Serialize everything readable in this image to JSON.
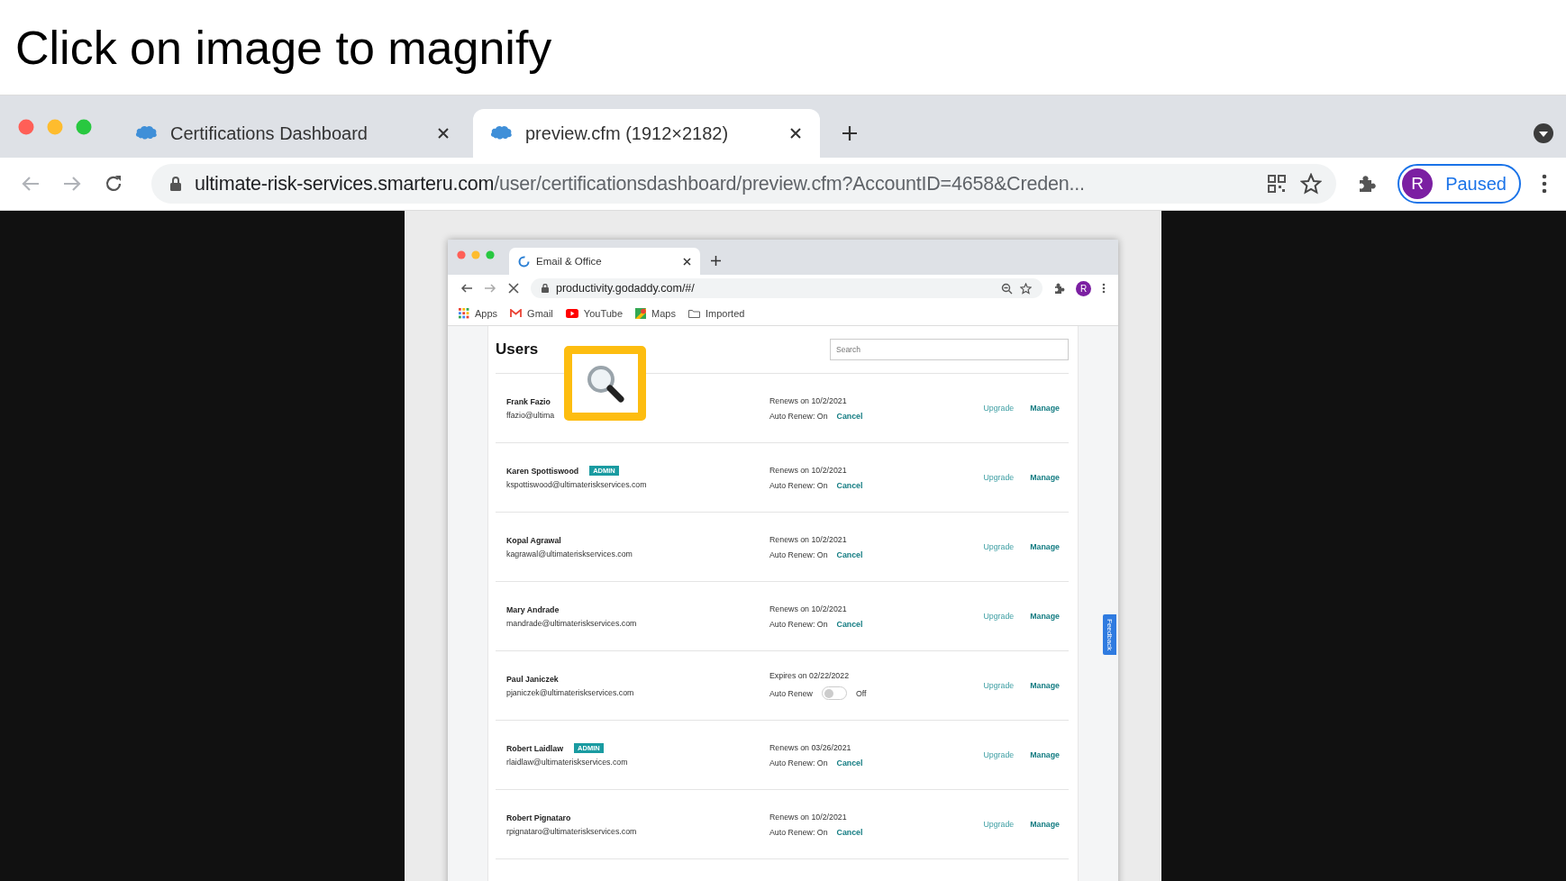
{
  "slide_title": "Click on image to magnify",
  "browser": {
    "tabs": [
      {
        "label": "Certifications Dashboard",
        "selected": false
      },
      {
        "label": "preview.cfm (1912×2182)",
        "selected": true
      }
    ],
    "url": {
      "host": "ultimate-risk-services.smarteru.com",
      "path": "/user/certificationsdashboard/preview.cfm?AccountID=4658&Creden..."
    },
    "profile": {
      "initial": "R",
      "label": "Paused"
    }
  },
  "screenshot": {
    "tabs": [
      {
        "label": "Email & Office",
        "selected": true
      }
    ],
    "url": "productivity.godaddy.com/#/",
    "profile_initial": "R",
    "bookmarks": [
      {
        "kind": "apps",
        "label": "Apps"
      },
      {
        "kind": "gmail",
        "label": "Gmail"
      },
      {
        "kind": "youtube",
        "label": "YouTube"
      },
      {
        "kind": "maps",
        "label": "Maps"
      },
      {
        "kind": "folder",
        "label": "Imported"
      }
    ],
    "heading": "Users",
    "search": {
      "placeholder": "Search"
    },
    "users": [
      {
        "name": "Frank Fazio",
        "email": "ffazio@ultima",
        "renewal": {
          "kind": "renews",
          "date": "Renews on 10/2/2021",
          "auto": "Auto Renew: On",
          "action": "Cancel"
        },
        "actions": [
          "Upgrade",
          "Manage"
        ]
      },
      {
        "name": "Karen Spottiswood",
        "badge": "ADMIN",
        "email": "kspottiswood@ultimateriskservices.com",
        "renewal": {
          "kind": "renews",
          "date": "Renews on 10/2/2021",
          "auto": "Auto Renew: On",
          "action": "Cancel"
        },
        "actions": [
          "Upgrade",
          "Manage"
        ]
      },
      {
        "name": "Kopal Agrawal",
        "email": "kagrawal@ultimateriskservices.com",
        "renewal": {
          "kind": "renews",
          "date": "Renews on 10/2/2021",
          "auto": "Auto Renew: On",
          "action": "Cancel"
        },
        "actions": [
          "Upgrade",
          "Manage"
        ]
      },
      {
        "name": "Mary Andrade",
        "email": "mandrade@ultimateriskservices.com",
        "renewal": {
          "kind": "renews",
          "date": "Renews on 10/2/2021",
          "auto": "Auto Renew: On",
          "action": "Cancel"
        },
        "actions": [
          "Upgrade",
          "Manage"
        ]
      },
      {
        "name": "Paul Janiczek",
        "email": "pjaniczek@ultimateriskservices.com",
        "renewal": {
          "kind": "toggle",
          "date": "Expires on 02/22/2022",
          "auto": "Auto Renew",
          "on": false,
          "state": "Off"
        },
        "actions": [
          "Upgrade",
          "Manage"
        ]
      },
      {
        "name": "Robert Laidlaw",
        "badge": "ADMIN",
        "email": "rlaidlaw@ultimateriskservices.com",
        "renewal": {
          "kind": "renews",
          "date": "Renews on 03/26/2021",
          "auto": "Auto Renew: On",
          "action": "Cancel"
        },
        "actions": [
          "Upgrade",
          "Manage"
        ]
      },
      {
        "name": "Robert Pignataro",
        "email": "rpignataro@ultimateriskservices.com",
        "renewal": {
          "kind": "renews",
          "date": "Renews on 10/2/2021",
          "auto": "Auto Renew: On",
          "action": "Cancel"
        },
        "actions": [
          "Upgrade",
          "Manage"
        ]
      }
    ],
    "feedback": "Feedback"
  }
}
